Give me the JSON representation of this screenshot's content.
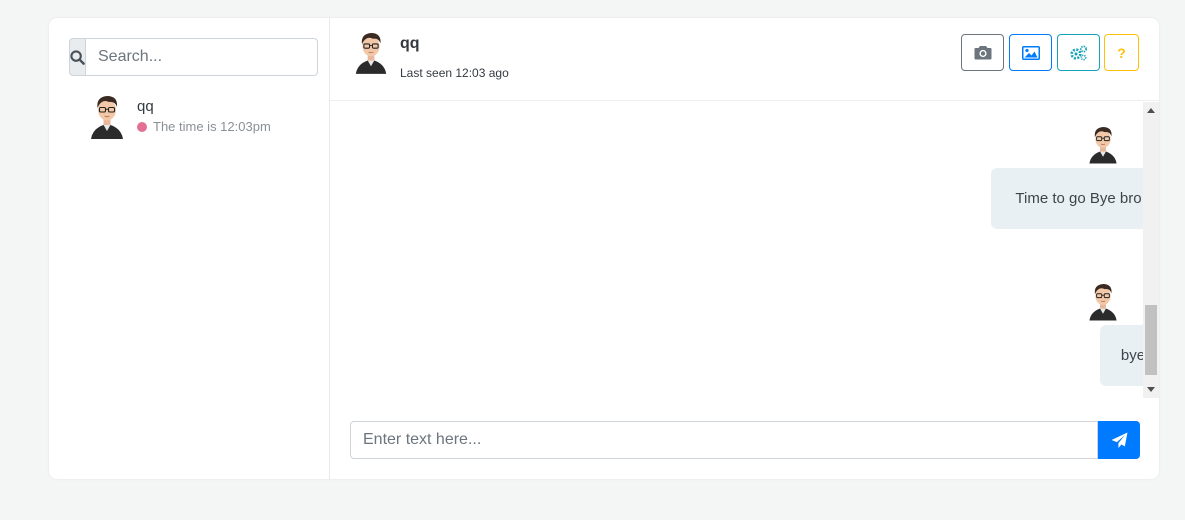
{
  "sidebar": {
    "search": {
      "placeholder": "Search...",
      "icon": "search-icon"
    },
    "contacts": [
      {
        "name": "qq",
        "status_text": "The time is 12:03pm",
        "status_color": "#e37092",
        "avatar": "avatar-man-glasses"
      }
    ]
  },
  "chat": {
    "header": {
      "name": "qq",
      "last_seen": "Last seen 12:03 ago",
      "buttons": [
        {
          "icon": "camera-icon",
          "color": "#6c757d"
        },
        {
          "icon": "image-icon",
          "color": "#007bff"
        },
        {
          "icon": "cogs-icon",
          "color": "#17a2b8"
        },
        {
          "icon": "help-icon",
          "label": "?",
          "color": "#ffc107"
        }
      ]
    },
    "messages": [
      {
        "text": "Time to go Bye bro",
        "side": "right"
      },
      {
        "text": "bye",
        "side": "right"
      }
    ],
    "composer": {
      "placeholder": "Enter text here...",
      "send_icon": "paper-plane-icon"
    }
  },
  "colors": {
    "primary": "#007bff",
    "bubble": "#e9f0f3",
    "background": "#f4f5f5"
  }
}
